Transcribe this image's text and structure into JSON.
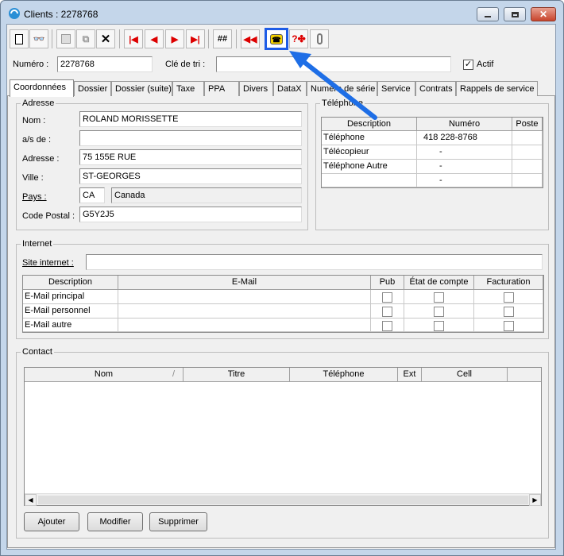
{
  "window": {
    "title": "Clients : 2278768"
  },
  "header": {
    "numero_label": "Numéro :",
    "numero_value": "2278768",
    "cle_label": "Clé de tri :",
    "cle_value": "",
    "actif_label": "Actif",
    "actif_checked": true
  },
  "tabs": [
    "Coordonnées",
    "Dossier",
    "Dossier (suite)",
    "Taxe",
    "PPA",
    "Divers",
    "DataX",
    "Numéro de série",
    "Service",
    "Contrats",
    "Rappels de service"
  ],
  "adresse": {
    "title": "Adresse",
    "nom_label": "Nom :",
    "nom_value": "ROLAND MORISSETTE",
    "as_label": "a/s de :",
    "as_value": "",
    "adresse_label": "Adresse :",
    "adresse_value": "75 155E RUE",
    "ville_label": "Ville :",
    "ville_value": "ST-GEORGES",
    "pays_label": "Pays :",
    "pays_code": "CA",
    "pays_name": "Canada",
    "cp_label": "Code Postal :",
    "cp_value": "G5Y2J5"
  },
  "telephone": {
    "title": "Téléphone",
    "headers": [
      "Description",
      "Numéro",
      "Poste"
    ],
    "rows": [
      [
        "Téléphone",
        "418 228-8768",
        ""
      ],
      [
        "Télécopieur",
        "-",
        ""
      ],
      [
        "Téléphone Autre",
        "-",
        ""
      ],
      [
        "",
        "-",
        ""
      ]
    ]
  },
  "internet": {
    "title": "Internet",
    "site_label": "Site internet :",
    "site_value": "",
    "headers": [
      "Description",
      "E-Mail",
      "Pub",
      "État de compte",
      "Facturation"
    ],
    "rows": [
      "E-Mail principal",
      "E-Mail personnel",
      "E-Mail autre"
    ]
  },
  "contact": {
    "title": "Contact",
    "headers": [
      "Nom",
      "Titre",
      "Téléphone",
      "Ext",
      "Cell"
    ]
  },
  "buttons": {
    "ajouter": "Ajouter",
    "modifier": "Modifier",
    "supprimer": "Supprimer"
  },
  "colors": {
    "highlight": "#1e5ce6",
    "arrow": "#1e6ee6"
  }
}
